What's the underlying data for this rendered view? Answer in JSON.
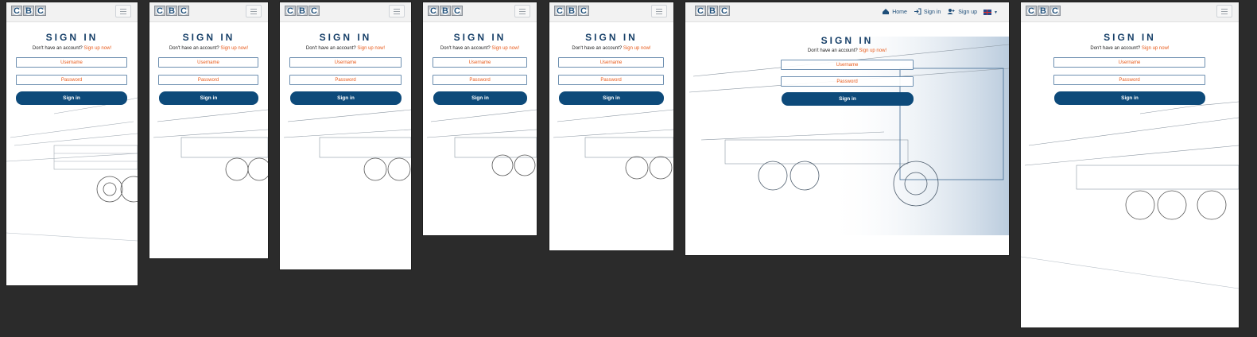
{
  "logo": {
    "letters": [
      "C",
      "B",
      "C"
    ]
  },
  "nav": {
    "home_label": "Home",
    "signin_label": "Sign in",
    "signup_label": "Sign up",
    "home_icon": "home-icon",
    "signin_icon": "sign-in-icon",
    "signup_icon": "add-user-icon",
    "language_icon": "uk-flag-icon",
    "menu_icon": "hamburger-menu-icon"
  },
  "form": {
    "title": "SIGN IN",
    "no_account_text": "Don't have an account?",
    "signup_link": "Sign up now!",
    "username_placeholder": "Username",
    "password_placeholder": "Password",
    "submit_label": "Sign in"
  },
  "colors": {
    "primary": "#0d4a7a",
    "accent": "#e85a1a",
    "backdrop": "#2b2b2b"
  }
}
